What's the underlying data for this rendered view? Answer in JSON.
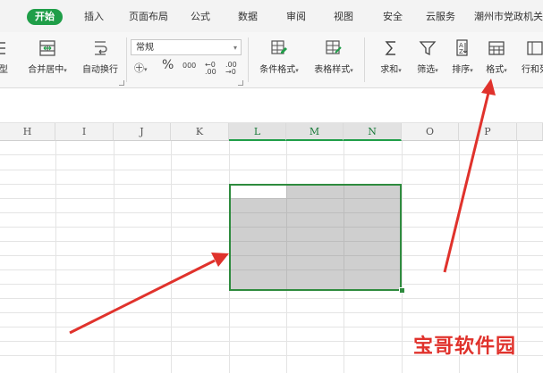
{
  "menu": {
    "tabs": [
      "开始",
      "插入",
      "页面布局",
      "公式",
      "数据",
      "审阅",
      "视图",
      "安全",
      "云服务",
      "潮州市党政机关"
    ]
  },
  "ribbon": {
    "merge_label": "合并居中",
    "wrap_label": "自动换行",
    "left_cut_label": "型",
    "number_format": "常规",
    "currency_symbol": "㊉",
    "percent_symbol": "%",
    "thousands_symbol": "000",
    "inc_decimal": "←0 .00",
    "dec_decimal": ".00 →0",
    "cond_format_label": "条件格式",
    "table_style_label": "表格样式",
    "sum_label": "求和",
    "filter_label": "筛选",
    "sort_label": "排序",
    "format_label": "格式",
    "rowcol_label": "行和列"
  },
  "columns": [
    "H",
    "I",
    "J",
    "K",
    "L",
    "M",
    "N",
    "O",
    "P"
  ],
  "watermark": "宝哥软件园",
  "colors": {
    "accent": "#1f9e48",
    "arrow": "#e0322c"
  }
}
